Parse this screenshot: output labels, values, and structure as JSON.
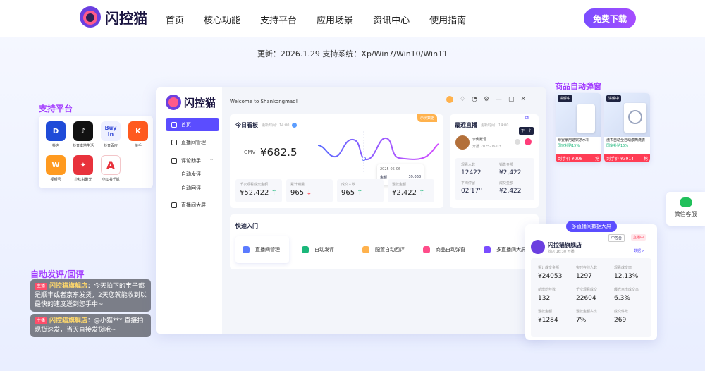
{
  "header": {
    "logo_text": "闪控猫",
    "nav": [
      "首页",
      "核心功能",
      "支持平台",
      "应用场景",
      "资讯中心",
      "使用指南"
    ],
    "download_label": "免费下载"
  },
  "update_line": "更新：2026.1.29 支持系统：Xp/Win7/Win10/Win11",
  "support": {
    "title": "支持平台",
    "platforms": [
      {
        "label": "抖店",
        "color": "#1f4bd8",
        "glyph": "D"
      },
      {
        "label": "抖音本地生活",
        "color": "#111111",
        "glyph": "♪"
      },
      {
        "label": "抖音百应",
        "color": "#eef0ff",
        "glyph": "Buy in"
      },
      {
        "label": "快手",
        "color": "#ff5a1f",
        "glyph": "K"
      },
      {
        "label": "视频号",
        "color": "#ff9a1f",
        "glyph": "W"
      },
      {
        "label": "小红书聚光",
        "color": "#e8323c",
        "glyph": "✦"
      },
      {
        "label": "小红书千帆",
        "color": "#ffffff",
        "glyph": "A"
      }
    ]
  },
  "comments": {
    "title": "自动发评/回评",
    "items": [
      {
        "tag": "主播",
        "shop": "闪控猫旗舰店",
        "text": "：今天拍下的宝子都是顺丰或者京东发货，2天您就能收到以最快的速度送到您手中~"
      },
      {
        "tag": "主播",
        "shop": "闪控猫旗舰店",
        "text": "：@小猫*** 直接拍现货速发，当天直接发货哦~"
      }
    ]
  },
  "app": {
    "logo_text": "闪控猫",
    "welcome": "Welcome to Shankongmao!",
    "menu": [
      "首页",
      "直播间管理",
      "评论助手",
      "自动发评",
      "自动回评",
      "直播间大屏"
    ],
    "today": {
      "title": "今日看板",
      "updated": "更新时间：14:00",
      "badge": "示例数据",
      "gmv_label": "GMV",
      "gmv_value": "¥682.5",
      "tooltip_date": "2025-05-06",
      "tooltip_label": "金额",
      "tooltip_value": "39,068",
      "stats": [
        {
          "k": "千次观看成交金额",
          "v": "¥52,422",
          "dir": "↑"
        },
        {
          "k": "累计销量",
          "v": "965",
          "dir": "↓"
        },
        {
          "k": "成交人数",
          "v": "965",
          "dir": "↑"
        },
        {
          "k": "退款金额",
          "v": "¥2,422",
          "dir": "↑"
        }
      ]
    },
    "recent": {
      "title": "最近直播",
      "updated": "更新时间：14:00",
      "account": "示例账号",
      "date": "开播 2025-06-03",
      "next_label": "下一个",
      "stats": [
        {
          "k": "观看人数",
          "v": "12422"
        },
        {
          "k": "销售金额",
          "v": "¥2,422"
        },
        {
          "k": "平均停留",
          "v": "02'17''"
        },
        {
          "k": "成交金额",
          "v": "¥2,422"
        }
      ]
    },
    "quick": {
      "title": "快速入门",
      "items": [
        "直播间管理",
        "自动发评",
        "配置自动回评",
        "商品自动弹窗",
        "多直播间大屏"
      ]
    }
  },
  "goods": {
    "title": "商品自动弹窗",
    "items": [
      {
        "badge": "讲解中",
        "name": "母婴家用速饮净水机",
        "sub": "国家补贴15%",
        "price": "到手价 ¥998",
        "btn": "抢"
      },
      {
        "badge": "讲解中",
        "name": "洗衣自动全自动滚筒洗衣",
        "sub": "国家补贴15%",
        "price": "到手价 ¥3914",
        "btn": "抢"
      }
    ]
  },
  "wechat_label": "微信客服",
  "dashboard": {
    "badge": "多直播间数据大屏",
    "shop_name": "闪控猫旗舰店",
    "shop_sub": "抖店  16:30 开播",
    "status_a": "中控台",
    "status_b": "直播中",
    "more": "数据 ∧",
    "cells": [
      {
        "k": "累计成交金额",
        "v": "¥24053"
      },
      {
        "k": "实时在线人数",
        "v": "1297"
      },
      {
        "k": "观看成交率",
        "v": "12.13%"
      },
      {
        "k": "新增粉丝数",
        "v": "132"
      },
      {
        "k": "千次观看成交",
        "v": "22604"
      },
      {
        "k": "曝光点击成交率",
        "v": "6.3%"
      },
      {
        "k": "退款金额",
        "v": "¥1284"
      },
      {
        "k": "退款金额占比",
        "v": "7%"
      },
      {
        "k": "成交件数",
        "v": "269"
      }
    ]
  },
  "colors": {
    "accent": "#5b4dff",
    "purple_title": "#a23bff",
    "price_red": "#ff3d55",
    "up_green": "#1bb77a"
  }
}
